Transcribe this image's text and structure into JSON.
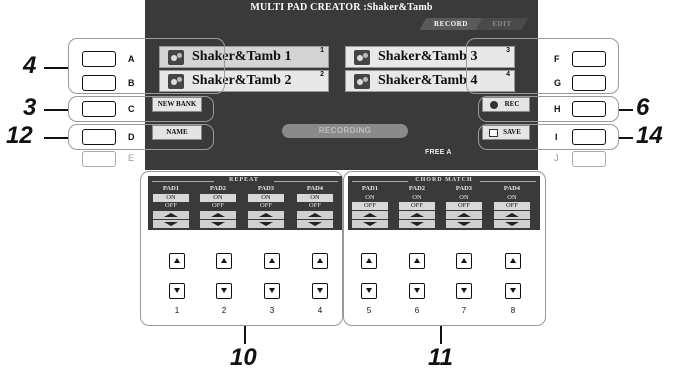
{
  "screen": {
    "title": "MULTI PAD CREATOR :Shaker&Tamb",
    "tabs": [
      {
        "label": "RECORD",
        "active": true
      },
      {
        "label": "EDIT",
        "active": false
      }
    ],
    "pads": [
      {
        "name": "Shaker&Tamb 1",
        "number": "1",
        "selected": true
      },
      {
        "name": "Shaker&Tamb 2",
        "number": "2",
        "selected": false
      },
      {
        "name": "Shaker&Tamb 3",
        "number": "3",
        "selected": false
      },
      {
        "name": "Shaker&Tamb 4",
        "number": "4",
        "selected": false
      }
    ],
    "new_bank_label": "NEW BANK",
    "name_label": "NAME",
    "rec_label": "REC",
    "save_label": "SAVE",
    "recording_label": "RECORDING",
    "free_text": "FREE A"
  },
  "side_buttons": {
    "left": [
      "A",
      "B",
      "C",
      "D",
      "E"
    ],
    "right": [
      "F",
      "G",
      "H",
      "I",
      "J"
    ]
  },
  "callouts": {
    "c4": "4",
    "c3": "3",
    "c12": "12",
    "c6": "6",
    "c14": "14",
    "c10": "10",
    "c11": "11"
  },
  "repeat": {
    "title": "REPEAT",
    "pads": [
      "PAD1",
      "PAD2",
      "PAD3",
      "PAD4"
    ],
    "on": [
      "ON",
      "ON",
      "ON",
      "ON"
    ],
    "off": [
      "OFF",
      "OFF",
      "OFF",
      "OFF"
    ],
    "state": [
      "ON",
      "ON",
      "ON",
      "ON"
    ]
  },
  "chord_match": {
    "title": "CHORD MATCH",
    "pads": [
      "PAD1",
      "PAD2",
      "PAD3",
      "PAD4"
    ],
    "on": [
      "ON",
      "ON",
      "ON",
      "ON"
    ],
    "off": [
      "OFF",
      "OFF",
      "OFF",
      "OFF"
    ],
    "state": [
      "OFF",
      "OFF",
      "OFF",
      "OFF"
    ]
  },
  "knob_numbers": [
    "1",
    "2",
    "3",
    "4",
    "5",
    "6",
    "7",
    "8"
  ],
  "colors": {
    "lcd_background": "#3a3a3a",
    "pad_slot": "#e8e8e8",
    "frame": "#9a9a9a"
  }
}
